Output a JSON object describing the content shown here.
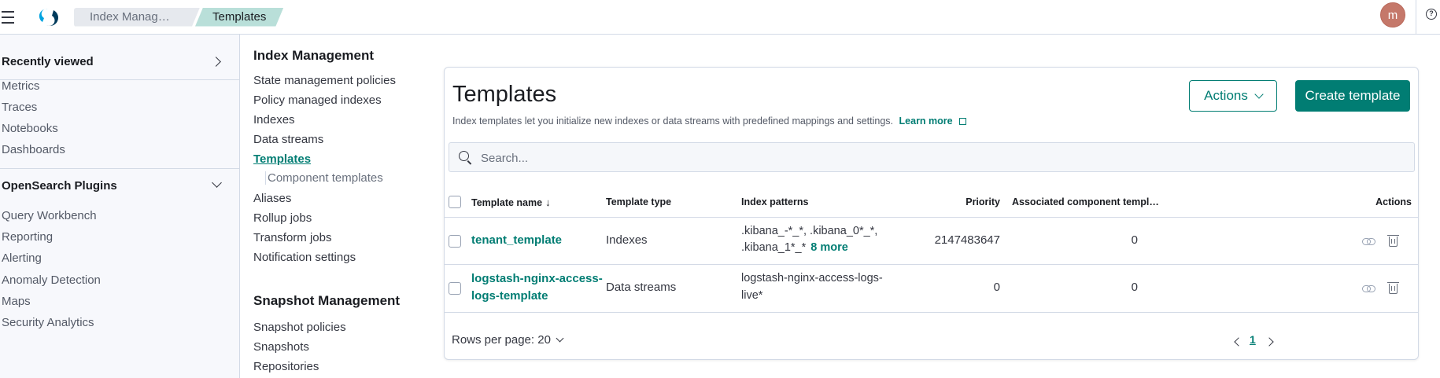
{
  "header": {
    "breadcrumbs": [
      "Index Manage…",
      "Templates"
    ],
    "avatar_initial": "m",
    "help_glyph": "?"
  },
  "leftnav": {
    "recently_viewed": "Recently viewed",
    "top_items": [
      "Metrics",
      "Traces",
      "Notebooks",
      "Dashboards"
    ],
    "plugins_section": "OpenSearch Plugins",
    "plugin_items": [
      "Query Workbench",
      "Reporting",
      "Alerting",
      "Anomaly Detection",
      "Maps",
      "Security Analytics"
    ]
  },
  "index_mgmt_nav": {
    "heading": "Index Management",
    "items": [
      "State management policies",
      "Policy managed indexes",
      "Indexes",
      "Data streams",
      "Templates",
      "Component templates",
      "Aliases",
      "Rollup jobs",
      "Transform jobs",
      "Notification settings"
    ],
    "snapshot_heading": "Snapshot Management",
    "snapshot_items": [
      "Snapshot policies",
      "Snapshots",
      "Repositories"
    ]
  },
  "panel": {
    "title": "Templates",
    "description": "Index templates let you initialize new indexes or data streams with predefined mappings and settings.",
    "learn_more": "Learn more",
    "actions_label": "Actions",
    "create_label": "Create template",
    "search_placeholder": "Search..."
  },
  "table": {
    "columns": [
      "Template name",
      "Template type",
      "Index patterns",
      "Priority",
      "Associated component templ…",
      "Actions"
    ],
    "sort_glyph": "↓",
    "rows": [
      {
        "name": "tenant_template",
        "type": "Indexes",
        "patterns_line1": ".kibana_-*_*, .kibana_0*_*,",
        "patterns_line2": ".kibana_1*_*",
        "more": "8 more",
        "priority": "2147483647",
        "components": "0"
      },
      {
        "name_line1": "logstash-nginx-access-",
        "name_line2": "logs-template",
        "type": "Data streams",
        "patterns_line1": "logstash-nginx-access-logs-",
        "patterns_line2": "live*",
        "priority": "0",
        "components": "0"
      }
    ]
  },
  "pagination": {
    "rows_per_page": "Rows per page: 20",
    "current_page": "1"
  },
  "colors": {
    "accent": "#017d73",
    "border": "#d3dae6",
    "avatar": "#c5786a"
  }
}
